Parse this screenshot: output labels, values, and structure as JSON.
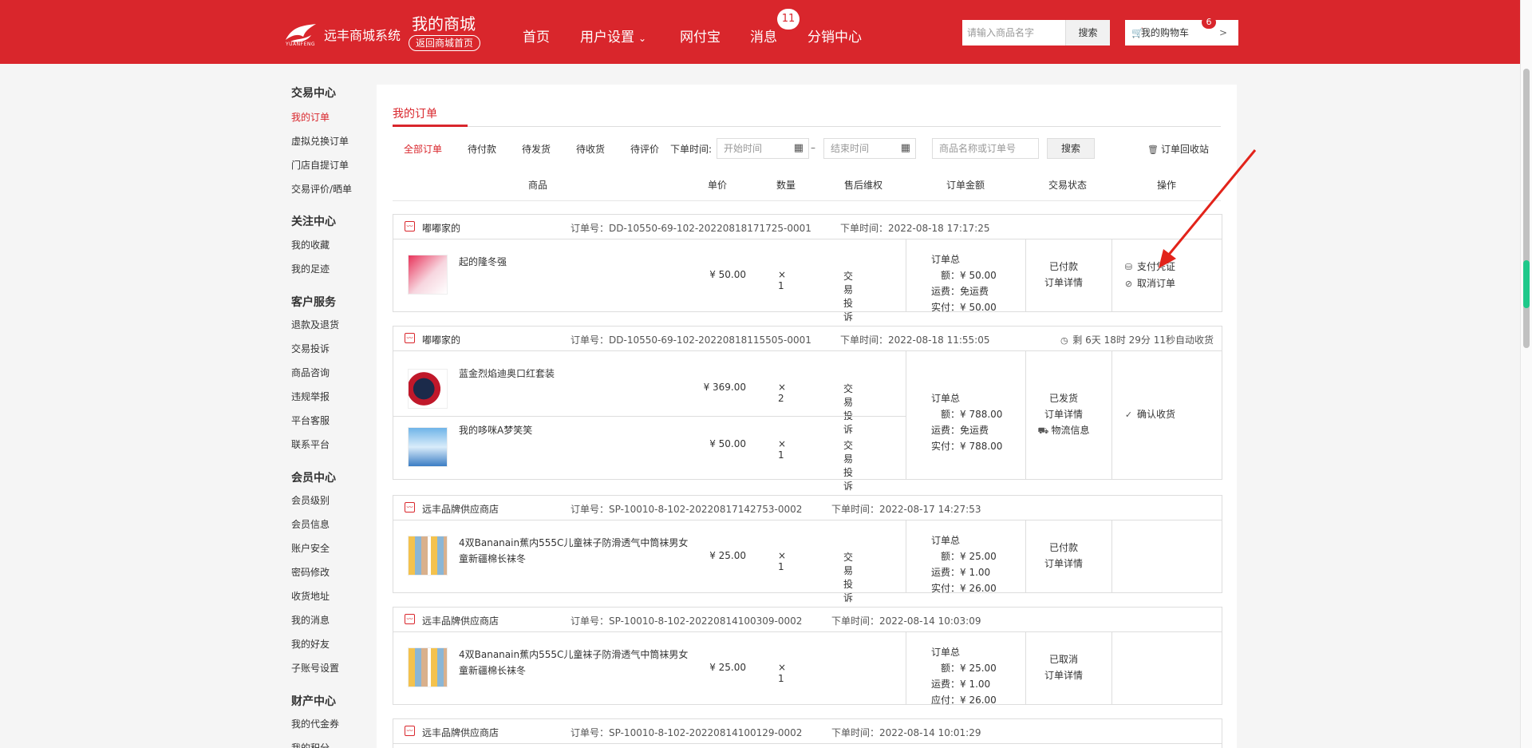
{
  "header": {
    "brand_name": "远丰商城系统",
    "brand_sub": "YUANFENG",
    "mall_title": "我的商城",
    "back_home": "返回商城首页",
    "nav": [
      "首页",
      "用户设置",
      "网付宝",
      "消息",
      "分销中心"
    ],
    "message_count": "11",
    "search_placeholder": "请输入商品名字",
    "search_button": "搜索",
    "cart_label": "我的购物车",
    "cart_count": "6",
    "cart_arrow": ">"
  },
  "sidebar": {
    "groups": [
      {
        "title": "交易中心",
        "items": [
          "我的订单",
          "虚拟兑换订单",
          "门店自提订单",
          "交易评价/晒单"
        ]
      },
      {
        "title": "关注中心",
        "items": [
          "我的收藏",
          "我的足迹"
        ]
      },
      {
        "title": "客户服务",
        "items": [
          "退款及退货",
          "交易投诉",
          "商品咨询",
          "违规举报",
          "平台客服",
          "联系平台"
        ]
      },
      {
        "title": "会员中心",
        "items": [
          "会员级别",
          "会员信息",
          "账户安全",
          "密码修改",
          "收货地址",
          "我的消息",
          "我的好友",
          "子账号设置"
        ]
      },
      {
        "title": "财产中心",
        "items": [
          "我的代金券",
          "我的积分"
        ]
      }
    ]
  },
  "main": {
    "tab": "我的订单",
    "filters": [
      "全部订单",
      "待付款",
      "待发货",
      "待收货",
      "待评价"
    ],
    "order_time_label": "下单时间:",
    "start_placeholder": "开始时间",
    "range_dash": "–",
    "end_placeholder": "结束时间",
    "keyword_placeholder": "商品名称或订单号",
    "search_button": "搜索",
    "recycle_bin": "订单回收站",
    "columns": [
      "商品",
      "单价",
      "数量",
      "售后维权",
      "订单金额",
      "交易状态",
      "操作"
    ]
  },
  "labels": {
    "order_no": "订单号：",
    "order_time": "下单时间：",
    "total": "订单总额：",
    "shipping": "运费：",
    "paid": "实付：",
    "payable": "应付："
  },
  "orders": [
    {
      "shop": "嘟嘟家的",
      "order_no": "DD-10550-69-102-20220818171725-0001",
      "time": "2022-08-18 17:17:25",
      "countdown": "",
      "items": [
        {
          "name": "起的隆冬强",
          "price": "¥ 50.00",
          "qty": "× 1",
          "after_sale": "交易投诉"
        }
      ],
      "total": "¥ 50.00",
      "shipping": "免运费",
      "pay_label": "实付：",
      "paid": "¥ 50.00",
      "status": [
        "已付款",
        "订单详情"
      ],
      "ops": [
        {
          "icon": "receipt-icon",
          "label": "支付凭证"
        },
        {
          "icon": "cancel-icon",
          "label": "取消订单"
        }
      ]
    },
    {
      "shop": "嘟嘟家的",
      "order_no": "DD-10550-69-102-20220818115505-0001",
      "time": "2022-08-18 11:55:05",
      "countdown": "剩 6天 18时 29分 11秒自动收货",
      "items": [
        {
          "name": "蓝金烈焰迪奥口红套装",
          "price": "¥ 369.00",
          "qty": "× 2",
          "after_sale": "交易投诉"
        },
        {
          "name": "我的哆咪A梦笑笑",
          "price": "¥ 50.00",
          "qty": "× 1",
          "after_sale": "交易投诉"
        }
      ],
      "total": "¥ 788.00",
      "shipping": "免运费",
      "pay_label": "实付：",
      "paid": "¥ 788.00",
      "status": [
        "已发货",
        "订单详情",
        "物流信息"
      ],
      "ops": [
        {
          "icon": "check-circle-icon",
          "label": "确认收货"
        }
      ]
    },
    {
      "shop": "远丰品牌供应商店",
      "order_no": "SP-10010-8-102-20220817142753-0002",
      "time": "2022-08-17 14:27:53",
      "countdown": "",
      "items": [
        {
          "name": "4双Bananain蕉内555C儿童袜子防滑透气中筒袜男女童新疆棉长袜冬",
          "price": "¥ 25.00",
          "qty": "× 1",
          "after_sale": "交易投诉"
        }
      ],
      "total": "¥ 25.00",
      "shipping": "¥ 1.00",
      "pay_label": "实付：",
      "paid": "¥ 26.00",
      "status": [
        "已付款",
        "订单详情"
      ],
      "ops": []
    },
    {
      "shop": "远丰品牌供应商店",
      "order_no": "SP-10010-8-102-20220814100309-0002",
      "time": "2022-08-14 10:03:09",
      "countdown": "",
      "items": [
        {
          "name": "4双Bananain蕉内555C儿童袜子防滑透气中筒袜男女童新疆棉长袜冬",
          "price": "¥ 25.00",
          "qty": "× 1",
          "after_sale": ""
        }
      ],
      "total": "¥ 25.00",
      "shipping": "¥ 1.00",
      "pay_label": "应付：",
      "paid": "¥ 26.00",
      "status": [
        "已取消",
        "订单详情"
      ],
      "ops": []
    },
    {
      "shop": "远丰品牌供应商店",
      "order_no": "SP-10010-8-102-20220814100129-0002",
      "time": "2022-08-14 10:01:29",
      "countdown": "",
      "items": [],
      "total": "",
      "shipping": "",
      "pay_label": "",
      "paid": "",
      "status": [],
      "ops": []
    }
  ],
  "colors": {
    "brand_red": "#d9262c",
    "scroll_green": "#1ec88a"
  }
}
